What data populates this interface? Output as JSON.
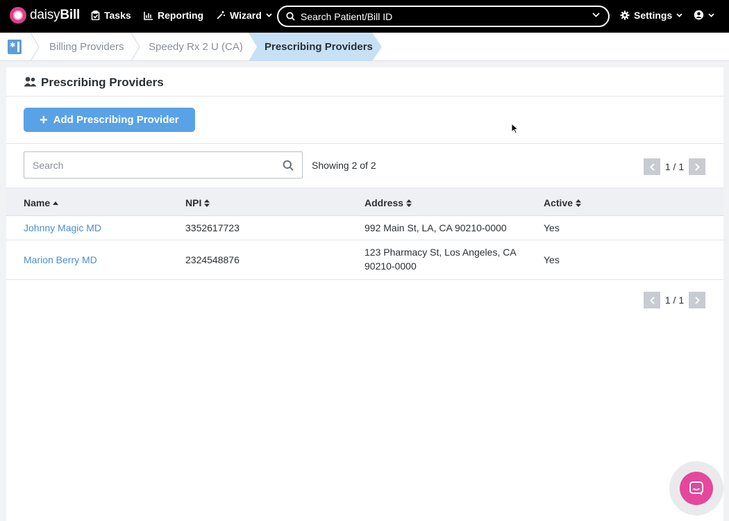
{
  "app": {
    "brand_light": "daisy",
    "brand_bold": "Bill",
    "accent_color": "#5aa2e6",
    "brand_color": "#e4479b"
  },
  "nav": {
    "tasks": "Tasks",
    "reporting": "Reporting",
    "wizard": "Wizard",
    "search_placeholder": "Search Patient/Bill ID",
    "settings": "Settings"
  },
  "breadcrumb": {
    "items": [
      "Billing Providers",
      "Speedy Rx 2 U (CA)"
    ],
    "current": "Prescribing Providers"
  },
  "page": {
    "title": "Prescribing Providers",
    "add_button": "Add Prescribing Provider",
    "search_placeholder": "Search",
    "showing": "Showing 2 of 2",
    "pager_top": "1 / 1",
    "pager_bottom": "1 / 1"
  },
  "table": {
    "columns": [
      "Name",
      "NPI",
      "Address",
      "Active"
    ],
    "sort": {
      "Name": "asc",
      "NPI": "none",
      "Address": "none",
      "Active": "none"
    },
    "rows": [
      {
        "name": "Johnny Magic MD",
        "npi": "3352617723",
        "address_line1": "992 Main St, LA, CA 90210-0000",
        "address_line2": "",
        "active": "Yes"
      },
      {
        "name": "Marion Berry MD",
        "npi": "2324548876",
        "address_line1": "123 Pharmacy St, Los Angeles, CA",
        "address_line2": "90210-0000",
        "active": "Yes"
      }
    ]
  },
  "icons": {
    "logo": "daisy-flower-icon",
    "tasks": "clipboard-check-icon",
    "reporting": "bar-chart-icon",
    "wizard": "magic-wand-icon",
    "settings": "gear-icon",
    "account": "user-circle-icon",
    "chat": "intercom-chat-icon"
  }
}
